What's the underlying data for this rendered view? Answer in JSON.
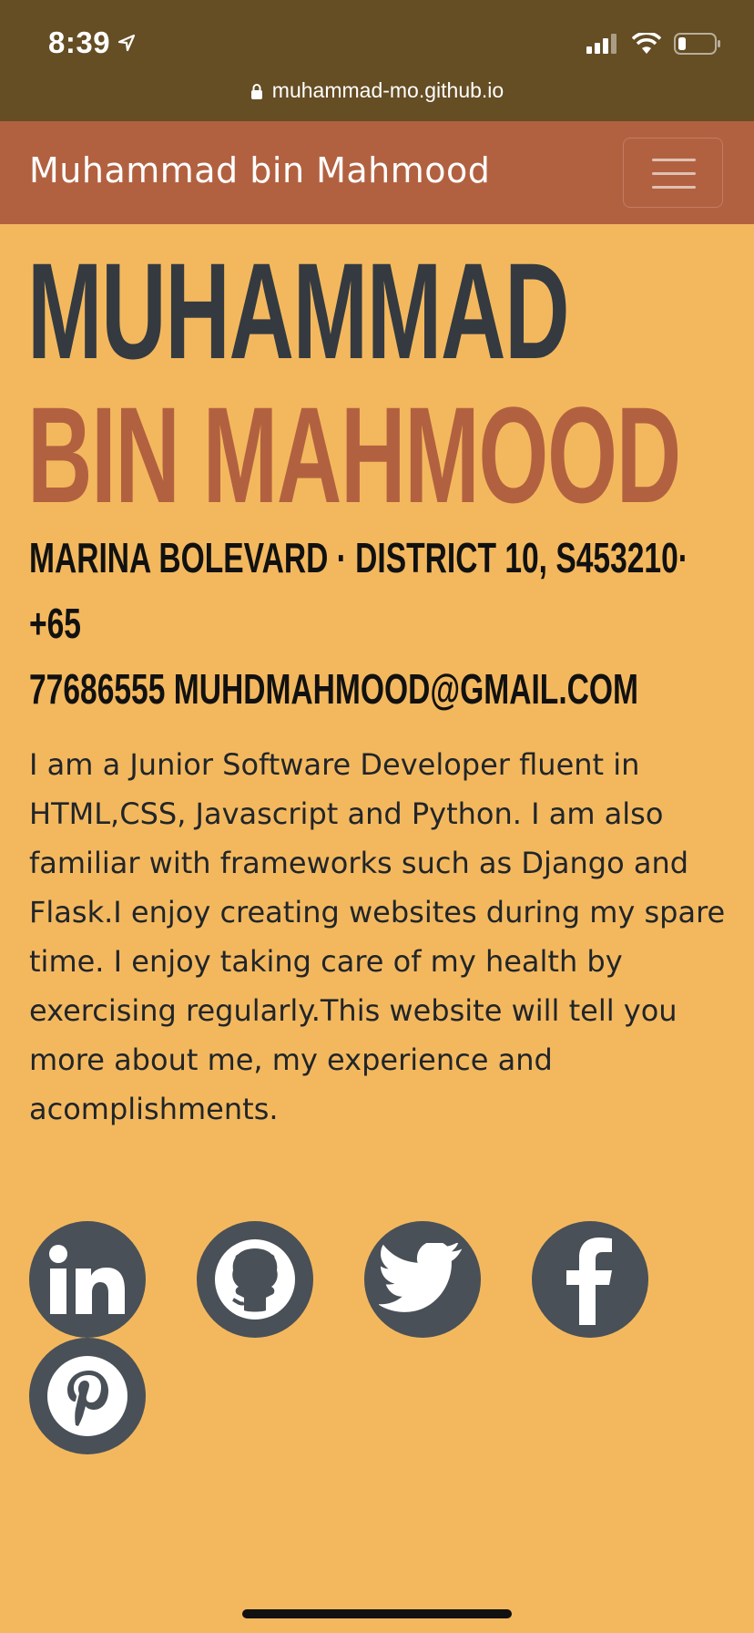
{
  "status_bar": {
    "time": "8:39"
  },
  "browser": {
    "url": "muhammad-mo.github.io"
  },
  "navbar": {
    "brand": "Muhammad bin Mahmood"
  },
  "header": {
    "first_name": "Muhammad",
    "last_name": "bin Mahmood",
    "contact_line1": "Marina Bolevard · District 10, S453210· +65",
    "contact_line2": "77686555 muhdmahmood@gmail.com"
  },
  "about": {
    "bio": "I am a Junior Software Developer fluent in HTML,CSS, Javascript and Python. I am also familiar with frameworks such as Django and Flask.I enjoy creating websites during my spare time. I enjoy taking care of my health by exercising regularly.This website will tell you more about me, my experience and acomplishments."
  },
  "social": [
    {
      "icon": "linkedin-icon"
    },
    {
      "icon": "github-icon"
    },
    {
      "icon": "twitter-icon"
    },
    {
      "icon": "facebook-icon"
    },
    {
      "icon": "pinterest-icon"
    }
  ],
  "colors": {
    "background": "#f3b85e",
    "navbar": "#b26140",
    "status_bar": "#654d24",
    "name_primary": "#343a40",
    "name_accent": "#b26140",
    "social_button": "#495057"
  }
}
